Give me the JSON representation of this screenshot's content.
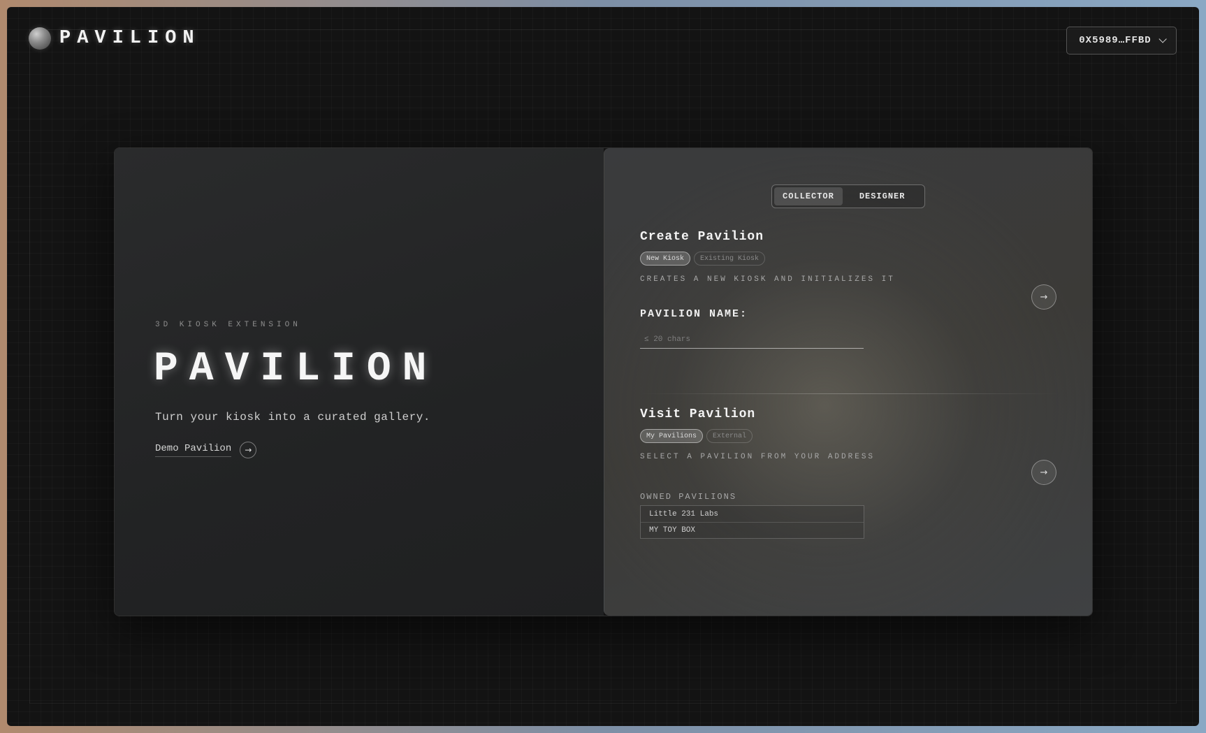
{
  "header": {
    "brand": "PAVILION",
    "wallet": "0X5989…FFBD"
  },
  "hero": {
    "eyebrow": "3D KIOSK EXTENSION",
    "title": "PAVILION",
    "tagline": "Turn your kiosk into a curated gallery.",
    "demo_link": "Demo Pavilion",
    "demo_icon": "arrow-right-icon"
  },
  "mode_toggle": {
    "options": [
      "COLLECTOR",
      "DESIGNER"
    ],
    "selected": "COLLECTOR"
  },
  "create": {
    "title": "Create Pavilion",
    "chips": [
      "New Kiosk",
      "Existing Kiosk"
    ],
    "selected_chip": "New Kiosk",
    "description": "CREATES A NEW KIOSK AND INITIALIZES IT",
    "field_label": "PAVILION NAME:",
    "field_placeholder": "≤ 20 chars",
    "field_value": ""
  },
  "visit": {
    "title": "Visit Pavilion",
    "chips": [
      "My Pavilions",
      "External"
    ],
    "selected_chip": "My Pavilions",
    "description": "SELECT A PAVILION FROM YOUR ADDRESS",
    "owned_label": "OWNED PAVILIONS",
    "owned": [
      "Little 231 Labs",
      "MY TOY BOX"
    ]
  },
  "colors": {
    "background": "#131313",
    "panel_left": "#262728",
    "panel_right": "#3b3b3a",
    "text": "#e8e8e8"
  }
}
